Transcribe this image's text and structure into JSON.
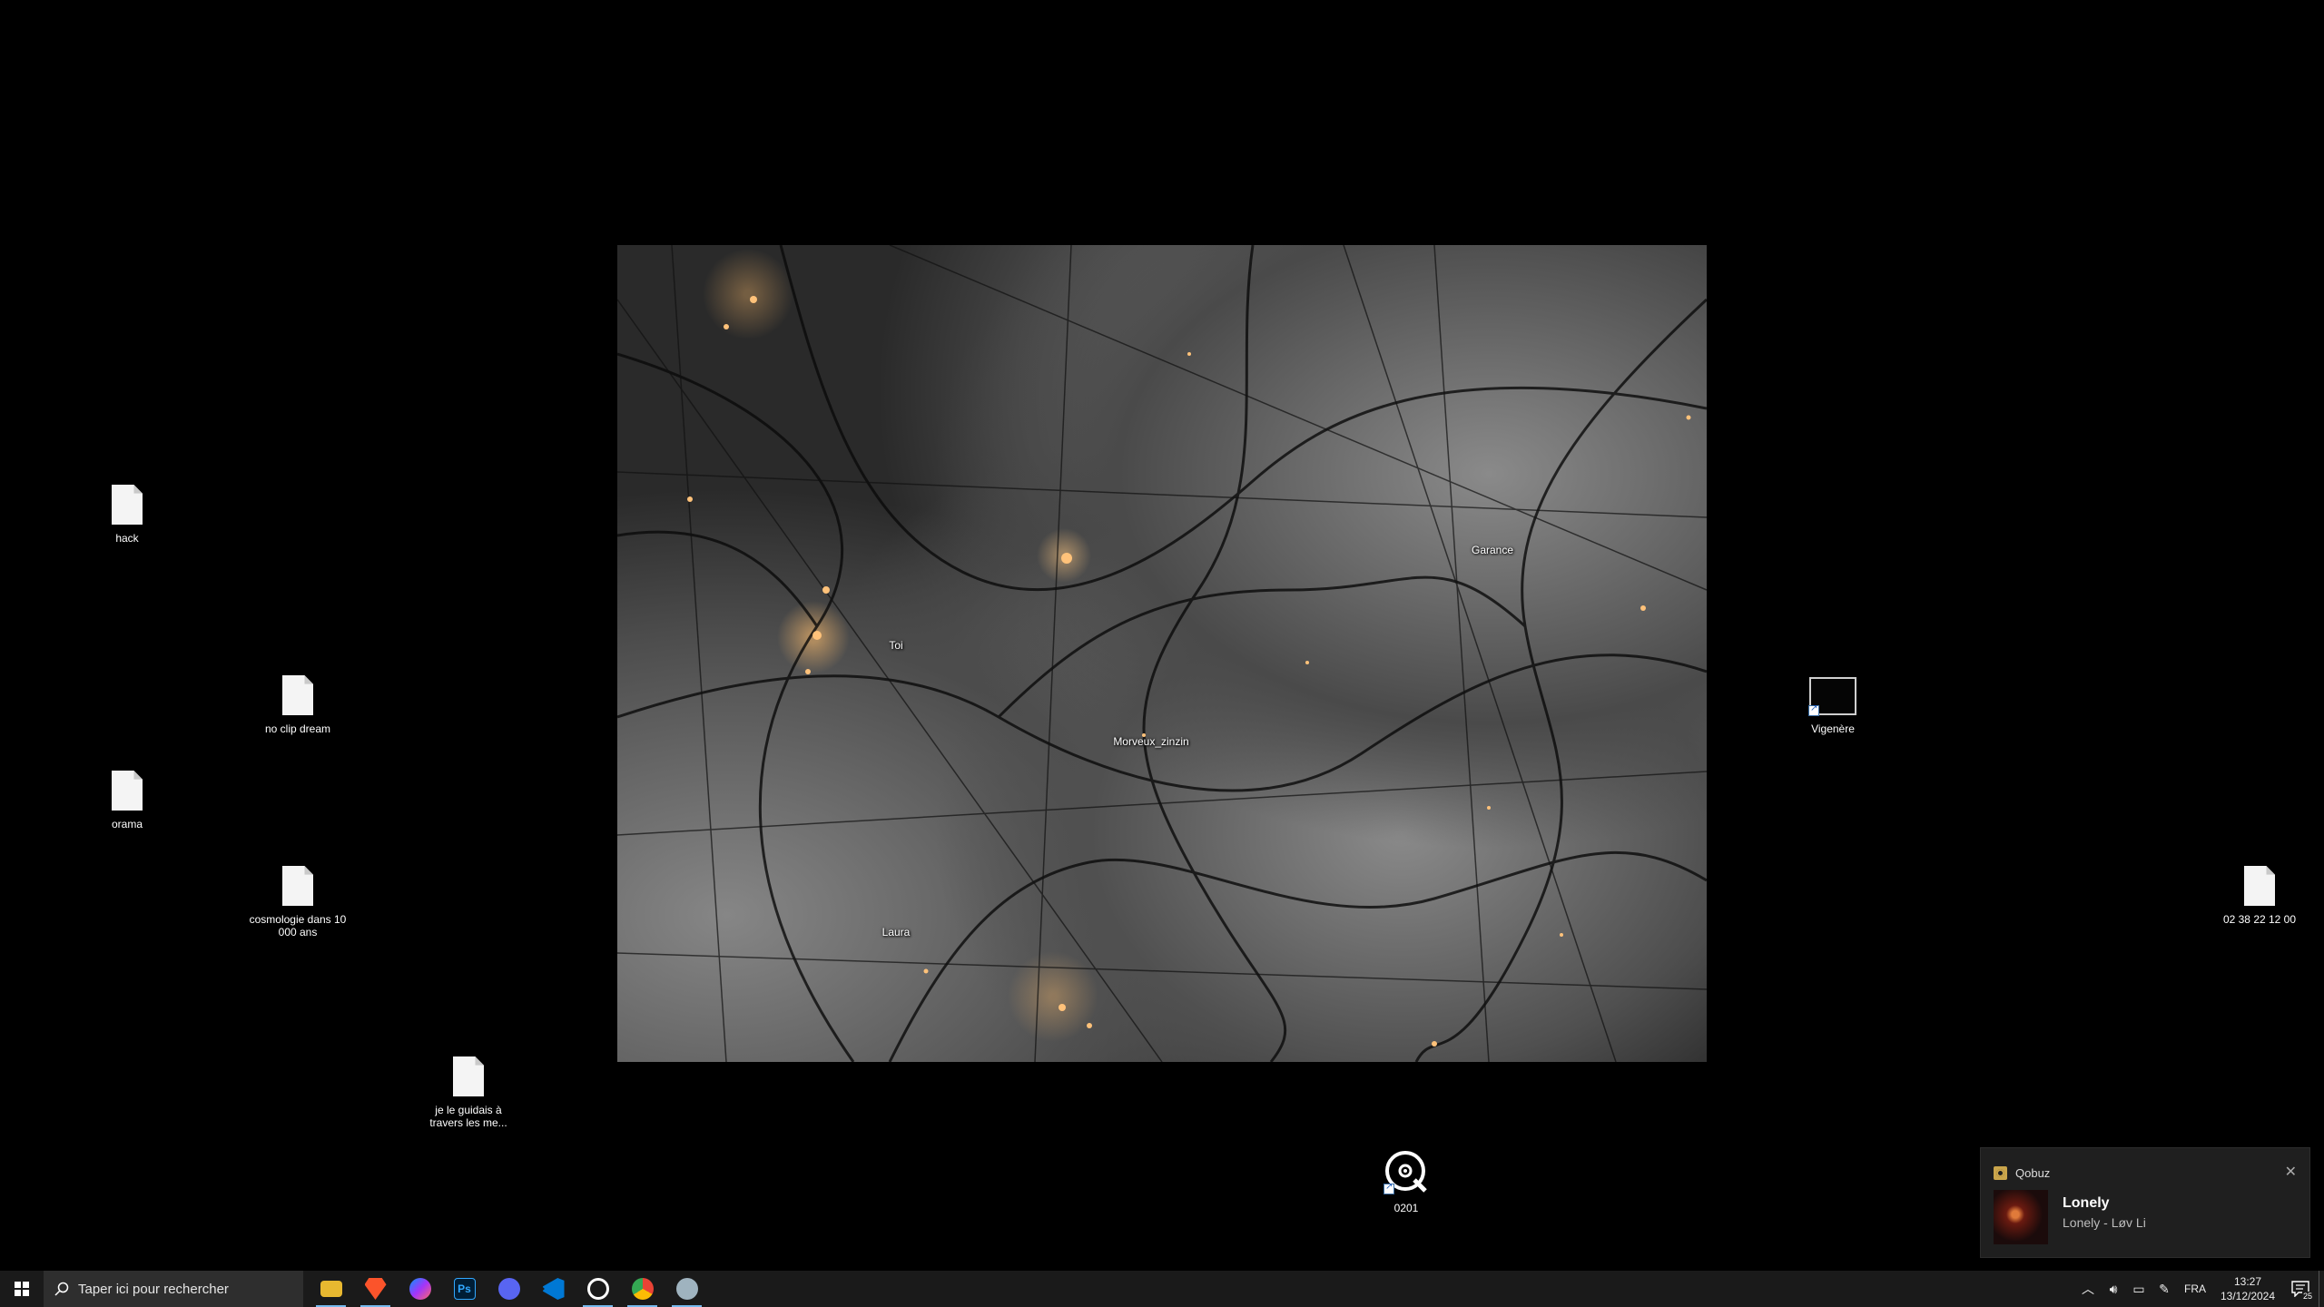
{
  "wallpaper_labels": [
    "Toi",
    "Garance",
    "Morveux_zinzin",
    "Laura"
  ],
  "desktop_icons": {
    "hack": "hack",
    "no_clip_dream": "no clip dream",
    "orama": "orama",
    "cosmologie": "cosmologie dans 10 000 ans",
    "je_le_guidais": "je le guidais à travers les me...",
    "vigenere": "Vigenère",
    "phone_file": "02 38 22 12 00",
    "qobuz_0201": "0201"
  },
  "toast": {
    "app_name": "Qobuz",
    "title": "Lonely",
    "subtitle": "Lonely - Løv Li",
    "close_glyph": "✕"
  },
  "taskbar": {
    "search_placeholder": "Taper ici pour rechercher",
    "apps": [
      {
        "name": "file-explorer",
        "color": "#f0c040",
        "glyph": "▬"
      },
      {
        "name": "brave",
        "color": "#fb542b",
        "glyph": "◆"
      },
      {
        "name": "messenger",
        "color": "#a040f0",
        "glyph": "◉"
      },
      {
        "name": "photoshop",
        "color": "#0c1b33",
        "glyph": "Ps"
      },
      {
        "name": "discord",
        "color": "#5865f2",
        "glyph": "◕"
      },
      {
        "name": "vscode",
        "color": "#1e88e5",
        "glyph": "❮❯"
      },
      {
        "name": "qobuz",
        "color": "#ffffff",
        "glyph": "◎"
      },
      {
        "name": "chrome",
        "color": "#e8453c",
        "glyph": "◍"
      },
      {
        "name": "other-app",
        "color": "#8aa",
        "glyph": "✈"
      }
    ],
    "language": "FRA",
    "time": "13:27",
    "date": "13/12/2024",
    "notification_count": "25"
  }
}
